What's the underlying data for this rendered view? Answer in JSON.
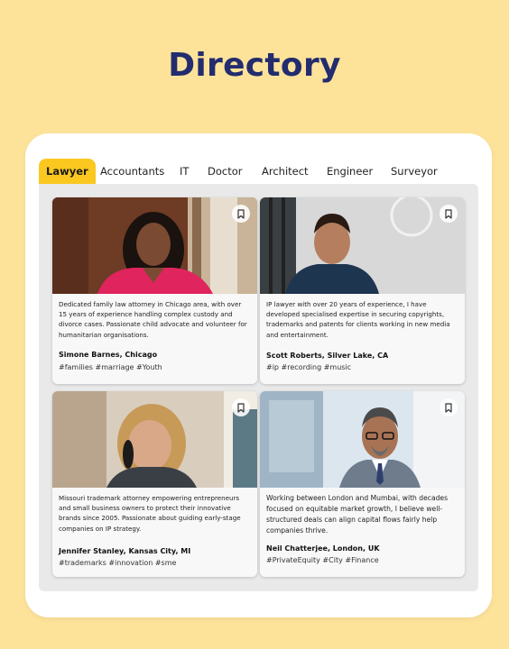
{
  "page": {
    "title": "Directory"
  },
  "tabs": [
    {
      "label": "Lawyer",
      "active": true
    },
    {
      "label": "Accountants"
    },
    {
      "label": "IT"
    },
    {
      "label": "Doctor"
    },
    {
      "label": "Architect"
    },
    {
      "label": "Engineer"
    },
    {
      "label": "Surveyor"
    }
  ],
  "profiles": [
    {
      "description": "Dedicated family law attorney in Chicago area, with over 15 years of experience handling complex custody and divorce cases. Passionate child advocate and volunteer for humanitarian organisations.",
      "name": "Simone Barnes, Chicago",
      "tags": "#families #marriage #Youth",
      "bookmark_icon": "bookmark-icon"
    },
    {
      "description": "IP lawyer with over 20 years of experience, I have developed specialised expertise in securing copyrights, trademarks and patents for clients working in new media and entertainment.",
      "name": "Scott Roberts, Silver Lake, CA",
      "tags": "#ip #recording #music",
      "bookmark_icon": "bookmark-icon"
    },
    {
      "description": "Missouri trademark attorney empowering entrepreneurs and small business owners to protect their innovative brands since 2005. Passionate about  guiding early-stage companies on IP strategy.",
      "name": "Jennifer Stanley, Kansas City, MI",
      "tags": "#trademarks #innovation #sme",
      "bookmark_icon": "bookmark-icon"
    },
    {
      "description": "Working between London and Mumbai, with decades focused on equitable market growth, I believe well-structured deals can align capital flows  fairly help companies thrive.",
      "name": "Neil Chatterjee, London, UK",
      "tags": "#PrivateEquity #City #Finance",
      "bookmark_icon": "bookmark-icon"
    }
  ],
  "colors": {
    "background": "#FDE39A",
    "title": "#232C6E",
    "active_tab": "#FAC81F",
    "panel": "#E9E9E9",
    "card": "#F8F8F8"
  }
}
